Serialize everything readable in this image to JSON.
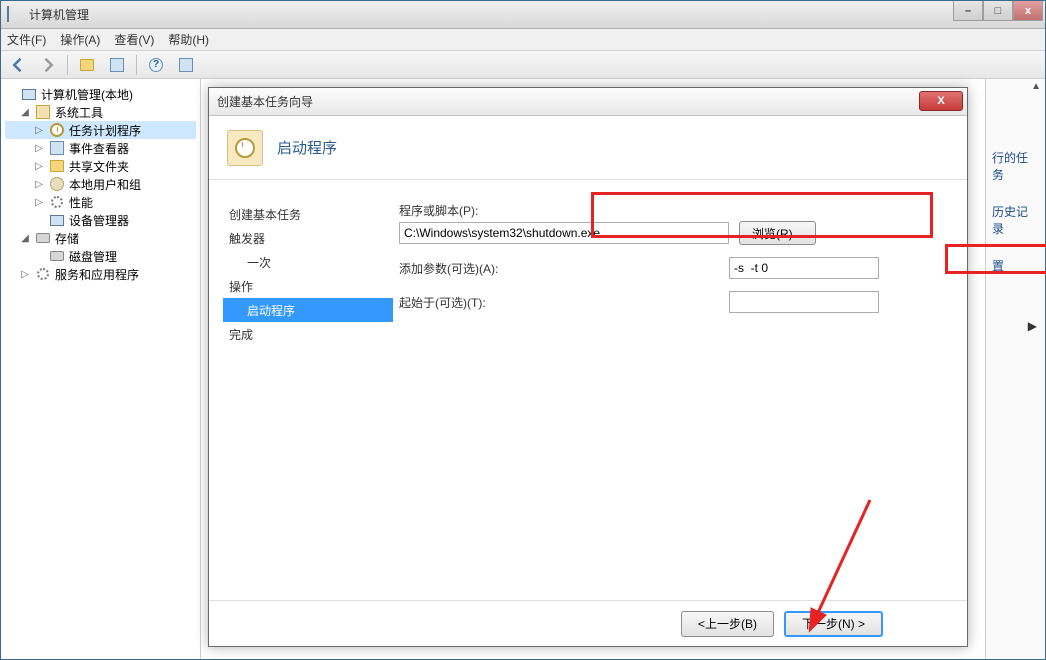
{
  "main_window": {
    "title": "计算机管理",
    "win_buttons": {
      "min": "–",
      "max": "□",
      "close": "x"
    }
  },
  "menu": {
    "file": "文件(F)",
    "action": "操作(A)",
    "view": "查看(V)",
    "help": "帮助(H)"
  },
  "tree": {
    "root": "计算机管理(本地)",
    "system_tools": "系统工具",
    "task_scheduler": "任务计划程序",
    "event_viewer": "事件查看器",
    "shared_folders": "共享文件夹",
    "local_users": "本地用户和组",
    "performance": "性能",
    "device_manager": "设备管理器",
    "storage": "存储",
    "disk_mgmt": "磁盘管理",
    "services_apps": "服务和应用程序"
  },
  "right_side": {
    "item1": "行的任务",
    "item2": "历史记录",
    "item3": "置"
  },
  "wizard": {
    "title": "创建基本任务向导",
    "header_title": "启动程序",
    "close_glyph": "X",
    "nav": {
      "create": "创建基本任务",
      "trigger": "触发器",
      "once": "一次",
      "action": "操作",
      "start_program": "启动程序",
      "finish": "完成"
    },
    "form": {
      "program_label": "程序或脚本(P):",
      "program_value": "C:\\Windows\\system32\\shutdown.exe",
      "browse": "浏览(R)...",
      "args_label": "添加参数(可选)(A):",
      "args_value": "-s  -t 0",
      "startin_label": "起始于(可选)(T):",
      "startin_value": ""
    },
    "footer": {
      "back": "<上一步(B)",
      "next": "下一步(N) >",
      "cancel": ""
    }
  }
}
